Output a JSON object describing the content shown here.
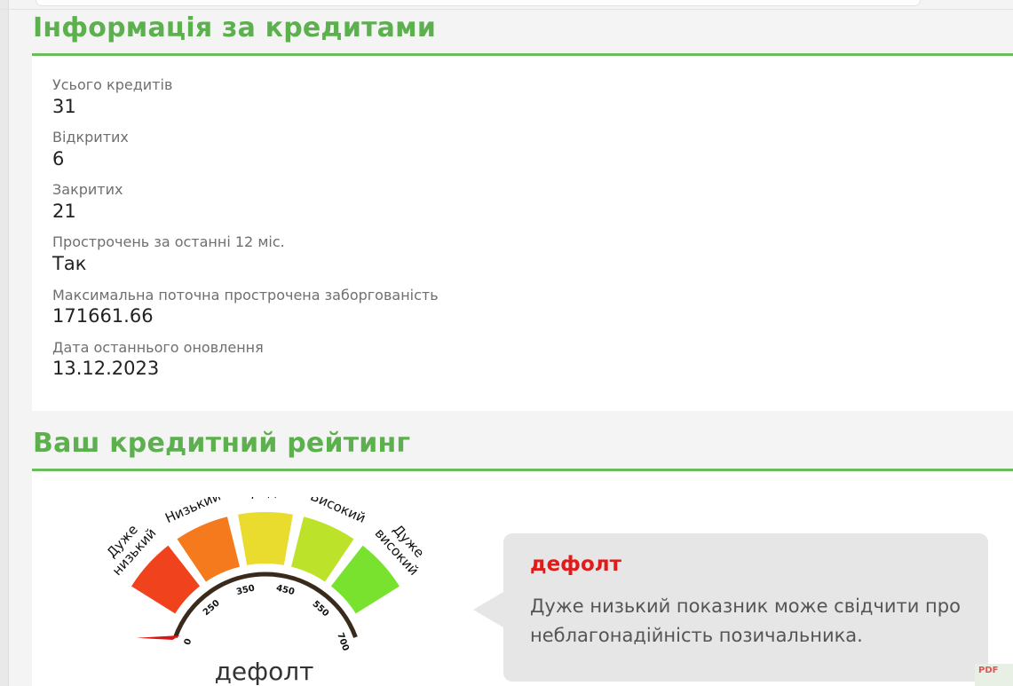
{
  "credits": {
    "title": "Інформація за кредитами",
    "fields": [
      {
        "label": "Усього кредитів",
        "value": "31"
      },
      {
        "label": "Відкритих",
        "value": "6"
      },
      {
        "label": "Закритих",
        "value": "21"
      },
      {
        "label": "Прострочень за останні 12 міс.",
        "value": "Так"
      },
      {
        "label": "Максимальна поточна прострочена заборгованість",
        "value": "171661.66"
      },
      {
        "label": "Дата останнього оновлення",
        "value": "13.12.2023"
      }
    ]
  },
  "rating": {
    "title": "Ваш кредитний рейтинг",
    "gauge": {
      "segments": [
        {
          "label": "Дуже низький",
          "color": "#f0421c"
        },
        {
          "label": "Низький",
          "color": "#f57a1e"
        },
        {
          "label": "Середній",
          "color": "#eadc2e"
        },
        {
          "label": "Високий",
          "color": "#bde22a"
        },
        {
          "label": "Дуже високий",
          "color": "#78e22e"
        }
      ],
      "ticks": [
        "0",
        "250",
        "350",
        "450",
        "550",
        "700"
      ],
      "needle_value": 0,
      "needle_color": "#d81616",
      "caption": "дефолт"
    },
    "status": {
      "title": "дефолт",
      "text": "Дуже низький показник може свідчити про неблагонадійність позичальника."
    }
  },
  "corner_badge": "PDF"
}
